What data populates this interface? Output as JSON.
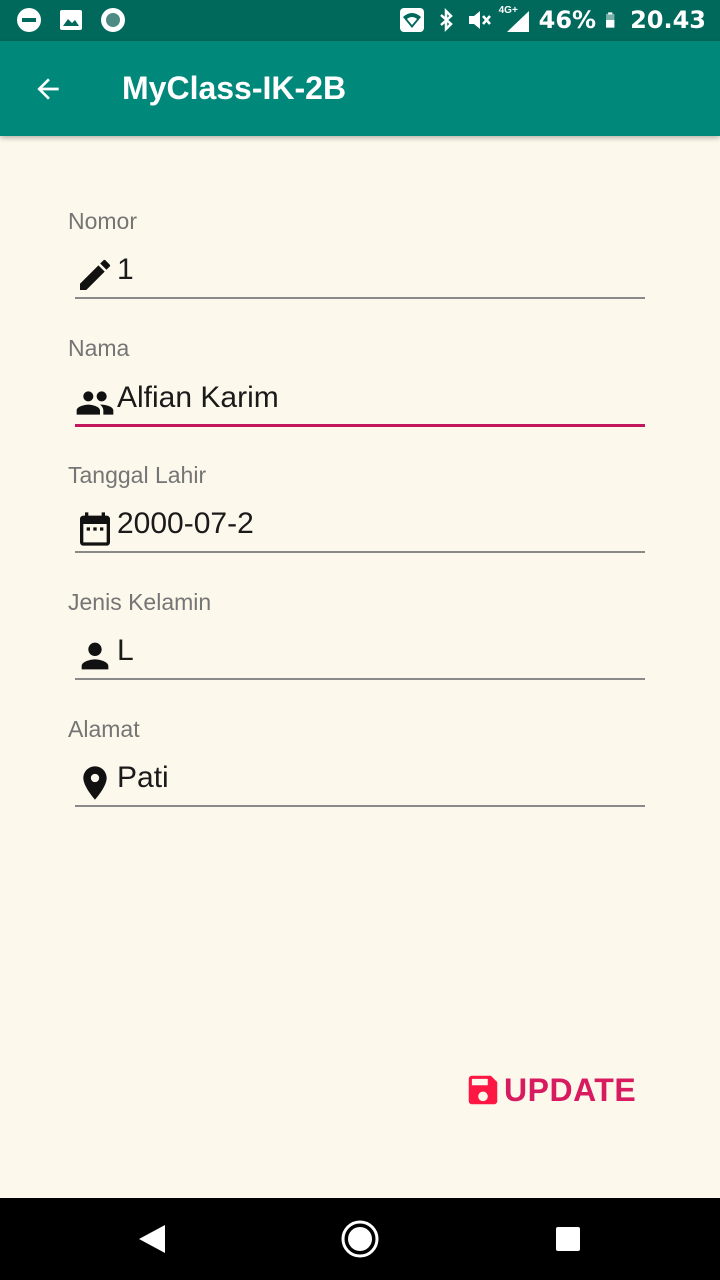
{
  "status_bar": {
    "network": "4G+",
    "battery": "46%",
    "time": "20.43"
  },
  "app_bar": {
    "title": "MyClass-IK-2B",
    "back_icon": "arrow-back-icon"
  },
  "form": {
    "fields": [
      {
        "label": "Nomor",
        "value": "1",
        "icon": "pencil-icon"
      },
      {
        "label": "Nama",
        "value": "Alfian Karim",
        "icon": "group-icon"
      },
      {
        "label": "Tanggal Lahir",
        "value": "2000-07-2",
        "icon": "calendar-icon"
      },
      {
        "label": "Jenis Kelamin",
        "value": "L",
        "icon": "person-icon"
      },
      {
        "label": "Alamat",
        "value": "Pati",
        "icon": "location-pin-icon"
      }
    ],
    "focused_field": "Nama"
  },
  "update_button": {
    "label": "UPDATE",
    "icon": "floppy-disk-icon",
    "icon_color": "#ff1744",
    "label_color": "#d81b60"
  },
  "colors": {
    "status_bar": "#00695c",
    "app_bar": "#00897b",
    "background": "#fdf8ec",
    "focus_underline": "#c2185b"
  }
}
